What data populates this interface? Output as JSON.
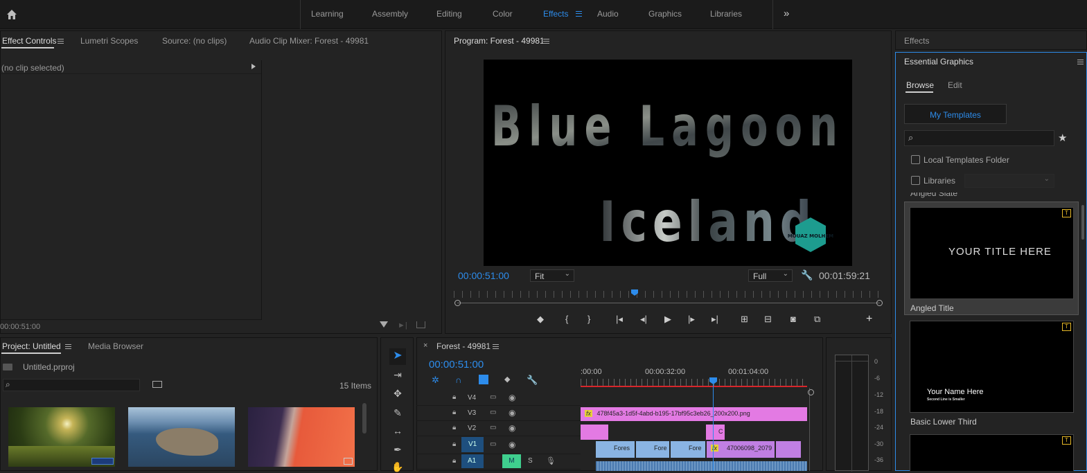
{
  "workspaces": [
    "Learning",
    "Assembly",
    "Editing",
    "Color",
    "Effects",
    "Audio",
    "Graphics",
    "Libraries"
  ],
  "active_workspace": "Effects",
  "effect_tabs": {
    "effect_controls": "Effect Controls",
    "lumetri": "Lumetri Scopes",
    "source": "Source: (no clips)",
    "audio_mixer": "Audio Clip Mixer: Forest - 49981"
  },
  "effect_controls": {
    "no_clip": "(no clip selected)",
    "timecode": "00:00:51:00"
  },
  "program": {
    "title": "Program: Forest - 49981",
    "timecode": "00:00:51:00",
    "fit": "Fit",
    "full": "Full",
    "duration": "00:01:59:21",
    "line1": "Blue Lagoon",
    "line2": "Iceland",
    "logo": "MOUAZ MOLHEM"
  },
  "project": {
    "tab": "Project: Untitled",
    "media_browser": "Media Browser",
    "file": "Untitled.prproj",
    "items": "15 Items"
  },
  "timeline": {
    "sequence": "Forest - 49981",
    "timecode": "00:00:51:00",
    "ruler": [
      ":00:00",
      "00:00:32:00",
      "00:01:04:00"
    ],
    "tracks": [
      "V4",
      "V3",
      "V2",
      "V1",
      "A1"
    ],
    "v3_clip": "478f45a3-1d5f-4abd-b195-17bf95c3eb26_200x200.png",
    "v1_clips": [
      "Fores",
      "Fore",
      "Fore",
      "47006098_2079"
    ],
    "v2_clip": "C",
    "a1_m": "M",
    "a1_s": "S"
  },
  "meter": [
    "0",
    "-6",
    "-12",
    "-18",
    "-24",
    "-30",
    "-36"
  ],
  "effects_panel": "Effects",
  "essential": {
    "title": "Essential Graphics",
    "browse": "Browse",
    "edit": "Edit",
    "my_templates": "My Templates",
    "local": "Local Templates Folder",
    "libraries": "Libraries",
    "cut_label": "Angled Slate",
    "templates": [
      {
        "name": "Angled Title",
        "text": "YOUR TITLE HERE"
      },
      {
        "name": "Basic Lower Third",
        "text": "Your Name Here",
        "sub": "Second Line is Smaller"
      }
    ]
  }
}
